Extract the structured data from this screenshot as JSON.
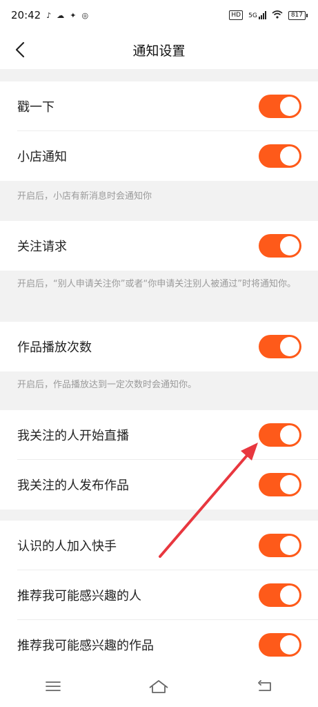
{
  "status_bar": {
    "time": "20:42",
    "left_icons": [
      "tiktok-icon",
      "cloud-icon",
      "app-icon",
      "weibo-icon"
    ],
    "hd": "HD",
    "network": "5G",
    "battery": "817"
  },
  "header": {
    "title": "通知设置"
  },
  "settings": [
    {
      "label": "戳一下",
      "enabled": true
    },
    {
      "label": "小店通知",
      "enabled": true
    },
    {
      "label": "关注请求",
      "enabled": true
    },
    {
      "label": "作品播放次数",
      "enabled": true
    },
    {
      "label": "我关注的人开始直播",
      "enabled": true
    },
    {
      "label": "我关注的人发布作品",
      "enabled": true
    },
    {
      "label": "认识的人加入快手",
      "enabled": true
    },
    {
      "label": "推荐我可能感兴趣的人",
      "enabled": true
    },
    {
      "label": "推荐我可能感兴趣的作品",
      "enabled": true
    }
  ],
  "notes": [
    "开启后，小店有新消息时会通知你",
    "开启后，“别人申请关注你”或者“你申请关注别人被通过”时将通知你。",
    "开启后，作品播放达到一定次数时会通知你。"
  ],
  "colors": {
    "toggle_on": "#fe5a1a",
    "annotation_arrow": "#e8373f"
  },
  "nav": [
    "menu-icon",
    "home-icon",
    "back-icon"
  ]
}
